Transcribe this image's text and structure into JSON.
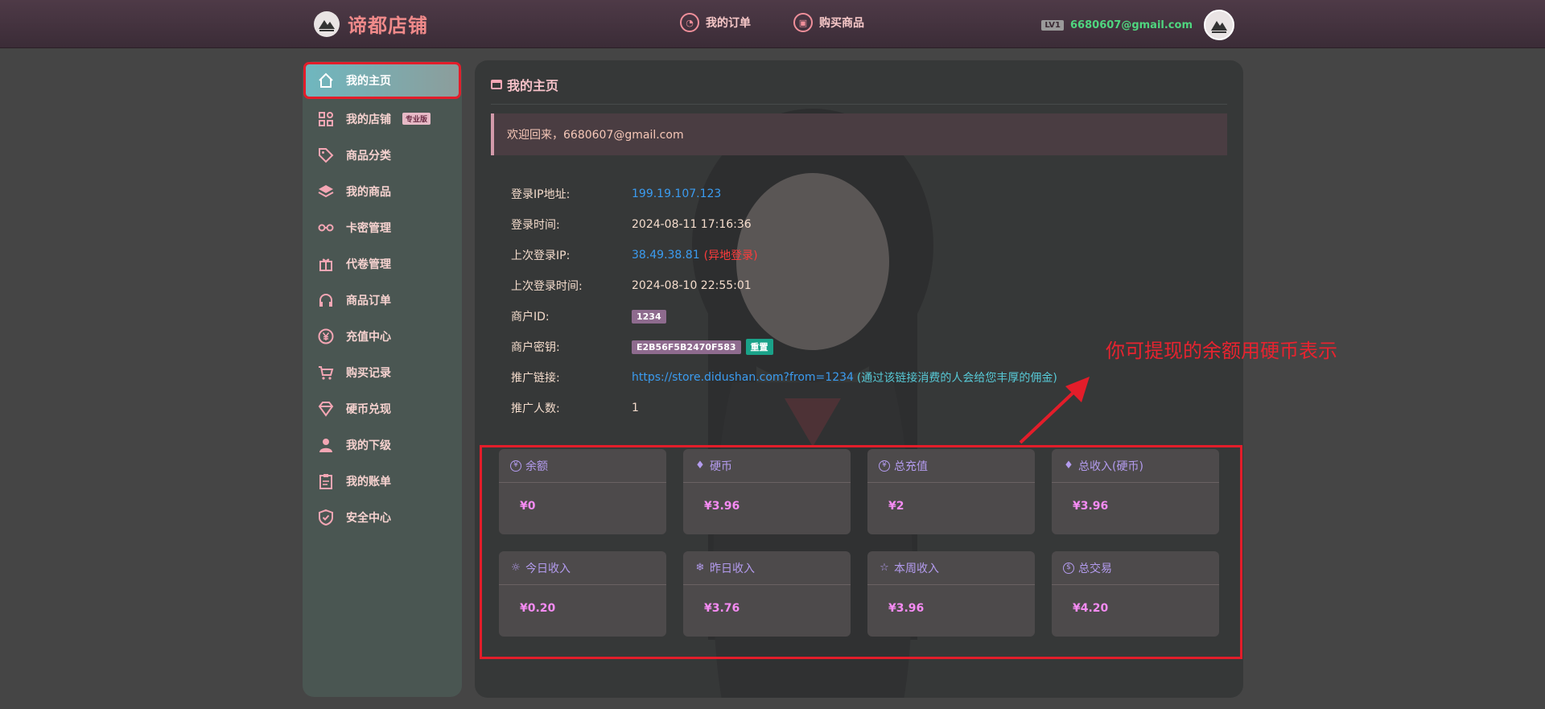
{
  "header": {
    "brand": "谛都店铺",
    "nav": [
      {
        "label": "我的订单",
        "icon": "order-icon"
      },
      {
        "label": "购买商品",
        "icon": "cart-bag-icon"
      }
    ],
    "level_badge": "LV1",
    "email": "6680607@gmail.com"
  },
  "sidebar": {
    "items": [
      {
        "label": "我的主页",
        "icon": "home-icon",
        "active": true
      },
      {
        "label": "我的店铺",
        "icon": "apps-icon",
        "badge": "专业版"
      },
      {
        "label": "商品分类",
        "icon": "tag-icon"
      },
      {
        "label": "我的商品",
        "icon": "layers-icon"
      },
      {
        "label": "卡密管理",
        "icon": "key-icon"
      },
      {
        "label": "代卷管理",
        "icon": "gift-icon"
      },
      {
        "label": "商品订单",
        "icon": "headset-icon"
      },
      {
        "label": "充值中心",
        "icon": "yen-circle-icon"
      },
      {
        "label": "购买记录",
        "icon": "cart-icon"
      },
      {
        "label": "硬币兑现",
        "icon": "diamond-icon"
      },
      {
        "label": "我的下级",
        "icon": "user-icon"
      },
      {
        "label": "我的账单",
        "icon": "clipboard-icon"
      },
      {
        "label": "安全中心",
        "icon": "shield-icon"
      }
    ]
  },
  "main": {
    "title": "我的主页",
    "welcome": "欢迎回来，6680607@gmail.com",
    "info": {
      "login_ip_label": "登录IP地址:",
      "login_ip": "199.19.107.123",
      "login_time_label": "登录时间:",
      "login_time": "2024-08-11 17:16:36",
      "last_ip_label": "上次登录IP:",
      "last_ip": "38.49.38.81",
      "last_ip_note": "(异地登录)",
      "last_time_label": "上次登录时间:",
      "last_time": "2024-08-10 22:55:01",
      "merchant_id_label": "商户ID:",
      "merchant_id": "1234",
      "merchant_key_label": "商户密钥:",
      "merchant_key": "E2B56F5B2470F583",
      "reset_label": "重置",
      "promo_link_label": "推广链接:",
      "promo_link": "https://store.didushan.com?from=1234",
      "promo_note": "(通过该链接消费的人会给您丰厚的佣金)",
      "promo_count_label": "推广人数:",
      "promo_count": "1"
    },
    "stats": [
      {
        "label": "余额",
        "icon": "yen-icon",
        "glyph": "¥",
        "value": "¥0"
      },
      {
        "label": "硬币",
        "icon": "diamond-icon",
        "glyph": "♦",
        "value": "¥3.96"
      },
      {
        "label": "总充值",
        "icon": "yen-icon",
        "glyph": "¥",
        "value": "¥2"
      },
      {
        "label": "总收入(硬币)",
        "icon": "diamond-icon",
        "glyph": "♦",
        "value": "¥3.96"
      },
      {
        "label": "今日收入",
        "icon": "sun-icon",
        "glyph": "☼",
        "value": "¥0.20"
      },
      {
        "label": "昨日收入",
        "icon": "snowflake-icon",
        "glyph": "❄",
        "value": "¥3.76"
      },
      {
        "label": "本周收入",
        "icon": "star-icon",
        "glyph": "☆",
        "value": "¥3.96"
      },
      {
        "label": "总交易",
        "icon": "dollar-icon",
        "glyph": "$",
        "value": "¥4.20"
      }
    ]
  },
  "annotation": {
    "text": "你可提现的余额用硬币表示"
  }
}
